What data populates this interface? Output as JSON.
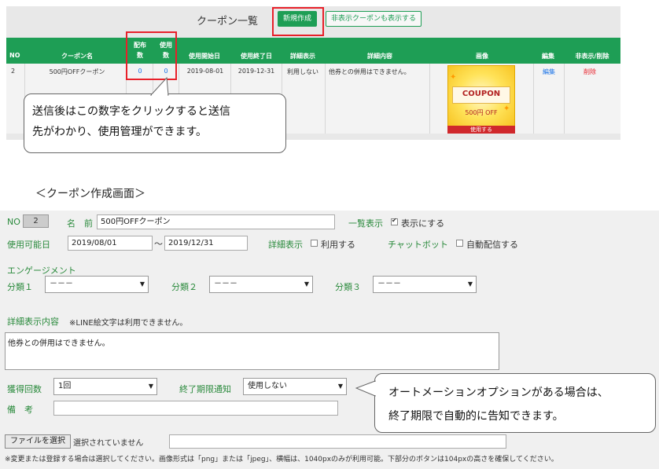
{
  "list": {
    "title": "クーポン一覧",
    "new_button": "新規作成",
    "show_hidden_button": "非表示クーポンも表示する",
    "columns": {
      "no": "NO",
      "name": "クーポン名",
      "distributed_1": "配布",
      "distributed_2": "数",
      "used_1": "使用",
      "used_2": "数",
      "start": "使用開始日",
      "end": "使用終了日",
      "detail_display": "詳細表示",
      "detail_content": "詳細内容",
      "image": "画像",
      "edit": "編集",
      "hide_delete": "非表示/削除"
    },
    "rows": [
      {
        "no": "2",
        "name": "500円OFFクーポン",
        "distributed": "0",
        "used": "0",
        "start": "2019-08-01",
        "end": "2019-12-31",
        "detail_display": "利用しない",
        "detail_content": "他券との併用はできません。",
        "image_word": "COUPON",
        "image_off": "500円 OFF",
        "image_use": "使用する",
        "edit": "編集",
        "delete": "削除"
      }
    ]
  },
  "callout_top": {
    "line1": "送信後はこの数字をクリックすると送信",
    "line2": "先がわかり、使用管理ができます。"
  },
  "section_title": "＜クーポン作成画面＞",
  "form": {
    "no_label": "NO",
    "no_value": "2",
    "name_label": "名　前",
    "name_value": "500円OFFクーポン",
    "list_display_label": "一覧表示",
    "list_display_option": "表示にする",
    "period_label": "使用可能日",
    "start_value": "2019/08/01",
    "tilde": "～",
    "end_value": "2019/12/31",
    "detail_display_label": "詳細表示",
    "detail_display_option": "利用する",
    "chatbot_label": "チャットボット",
    "chatbot_option": "自動配信する",
    "engagement_label": "エンゲージメント",
    "category1_label": "分類１",
    "category2_label": "分類２",
    "category3_label": "分類３",
    "category_placeholder": "－－－",
    "detail_content_label": "詳細表示内容",
    "detail_content_note": "※LINE絵文字は利用できません。",
    "detail_content_value": "他券との併用はできません。",
    "acquire_count_label": "獲得回数",
    "acquire_count_value": "1回",
    "expiry_notice_label": "終了期限通知",
    "expiry_notice_value": "使用しない",
    "remarks_label": "備　考",
    "file_button": "ファイルを選択",
    "file_status": "選択されていません",
    "image_notice": "※変更または登録する場合は選択してください。画像形式は「png」または「jpeg」、横幅は、1040pxのみが利用可能。下部分のボタンは104pxの高さを確保してください。"
  },
  "callout_bottom": {
    "line1": "オートメーションオプションがある場合は、",
    "line2": "終了期限で自動的に告知できます。"
  },
  "colors": {
    "accent_green": "#1e9e55",
    "highlight_red": "#e8202a",
    "link_blue": "#1a73e8",
    "delete_red": "#e8202a"
  }
}
